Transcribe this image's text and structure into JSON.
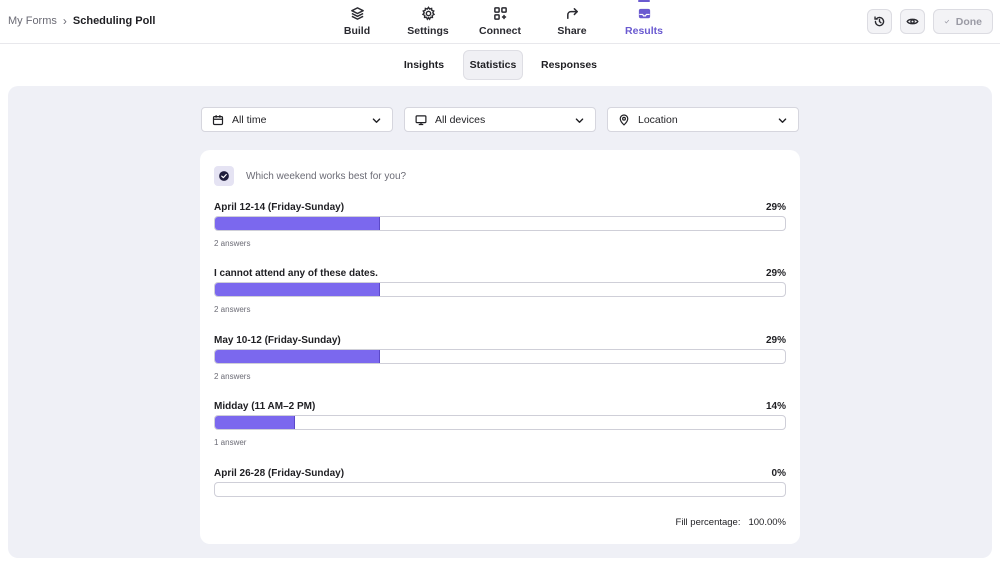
{
  "breadcrumb": {
    "parent": "My Forms",
    "separator": "›",
    "current": "Scheduling Poll"
  },
  "nav": [
    {
      "label": "Build",
      "icon": "layers-icon"
    },
    {
      "label": "Settings",
      "icon": "gear-icon"
    },
    {
      "label": "Connect",
      "icon": "grid-plus-icon"
    },
    {
      "label": "Share",
      "icon": "share-arrow-icon"
    },
    {
      "label": "Results",
      "icon": "inbox-icon",
      "active": true
    }
  ],
  "toolbar": {
    "history_icon": "history-icon",
    "preview_icon": "eye-icon",
    "done_label": "Done"
  },
  "subtabs": [
    {
      "label": "Insights"
    },
    {
      "label": "Statistics",
      "active": true
    },
    {
      "label": "Responses"
    }
  ],
  "filters": [
    {
      "label": "All time",
      "icon": "calendar-icon"
    },
    {
      "label": "All devices",
      "icon": "monitor-icon"
    },
    {
      "label": "Location",
      "icon": "map-pin-icon"
    }
  ],
  "question": {
    "text": "Which weekend works best for you?"
  },
  "options": [
    {
      "label": "April 12-14 (Friday-Sunday)",
      "percent_text": "29%",
      "fraction": 0.29,
      "count_text": "2 answers"
    },
    {
      "label": "I cannot attend any of these dates.",
      "percent_text": "29%",
      "fraction": 0.29,
      "count_text": "2 answers"
    },
    {
      "label": "May 10-12 (Friday-Sunday)",
      "percent_text": "29%",
      "fraction": 0.29,
      "count_text": "2 answers"
    },
    {
      "label": "Midday (11 AM–2 PM)",
      "percent_text": "14%",
      "fraction": 0.14,
      "count_text": "1 answer"
    },
    {
      "label": "April 26-28 (Friday-Sunday)",
      "percent_text": "0%",
      "fraction": 0,
      "count_text": ""
    }
  ],
  "fill_percentage": {
    "label": "Fill percentage:",
    "value": "100.00%"
  },
  "colors": {
    "accent": "#6a5ad0",
    "bar": "#7b68ee",
    "content_bg": "#eff0f6"
  }
}
